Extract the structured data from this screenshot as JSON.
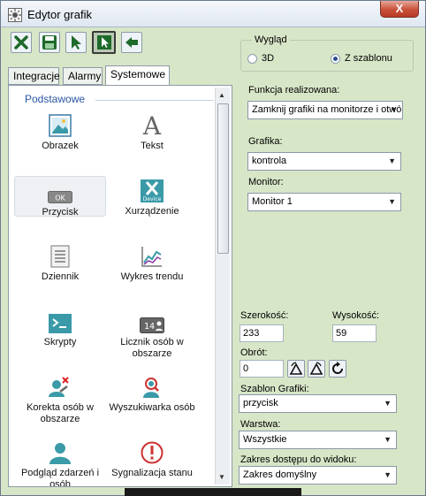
{
  "window": {
    "title": "Edytor grafik",
    "close_label": "X"
  },
  "toolbar": [
    {
      "name": "delete-icon"
    },
    {
      "name": "save-icon"
    },
    {
      "name": "pointer-icon"
    },
    {
      "name": "select-mode-icon"
    },
    {
      "name": "import-icon"
    }
  ],
  "tabs": [
    "Integracje",
    "Alarmy",
    "Systemowe"
  ],
  "palette": {
    "group": "Podstawowe",
    "items": [
      {
        "label": "Obrazek",
        "icon": "image-icon"
      },
      {
        "label": "Tekst",
        "icon": "text-icon"
      },
      {
        "label": "Przycisk",
        "icon": "button-icon",
        "icon_text": "OK"
      },
      {
        "label": "Xurządzenie",
        "icon": "device-icon",
        "icon_text": "Device"
      },
      {
        "label": "Dziennik",
        "icon": "journal-icon"
      },
      {
        "label": "Wykres trendu",
        "icon": "trend-chart-icon"
      },
      {
        "label": "Skrypty",
        "icon": "script-icon"
      },
      {
        "label": "Licznik osób w obszarze",
        "icon": "people-counter-icon",
        "icon_text": "14"
      },
      {
        "label": "Korekta osób w obszarze",
        "icon": "people-correction-icon"
      },
      {
        "label": "Wyszukiwarka osób",
        "icon": "person-search-icon"
      },
      {
        "label": "Podgląd zdarzeń i osób",
        "icon": "event-preview-icon"
      },
      {
        "label": "Sygnalizacja stanu",
        "icon": "status-signal-icon"
      }
    ]
  },
  "props": {
    "wyglad": {
      "title": "Wygląd",
      "opt3d": "3D",
      "optTemplate": "Z szablonu",
      "selected": "Z szablonu"
    },
    "funkcja": {
      "label": "Funkcja realizowana:",
      "value": "Zamknij grafiki na monitorze i otwórz"
    },
    "grafika": {
      "label": "Grafika:",
      "value": "kontrola"
    },
    "monitor": {
      "label": "Monitor:",
      "value": "Monitor 1"
    },
    "szerokosc": {
      "label": "Szerokość:",
      "value": "233"
    },
    "wysokosc": {
      "label": "Wysokość:",
      "value": "59"
    },
    "obrot": {
      "label": "Obrót:",
      "value": "0"
    },
    "szablon": {
      "label": "Szablon Grafiki:",
      "value": "przycisk"
    },
    "warstwa": {
      "label": "Warstwa:",
      "value": "Wszystkie"
    },
    "zakres": {
      "label": "Zakres dostępu do widoku:",
      "value": "Zakres domyślny"
    }
  },
  "colors": {
    "panel": "#d8e6c8",
    "accent_blue": "#2a55a5",
    "icon_teal": "#3a9aa8"
  }
}
